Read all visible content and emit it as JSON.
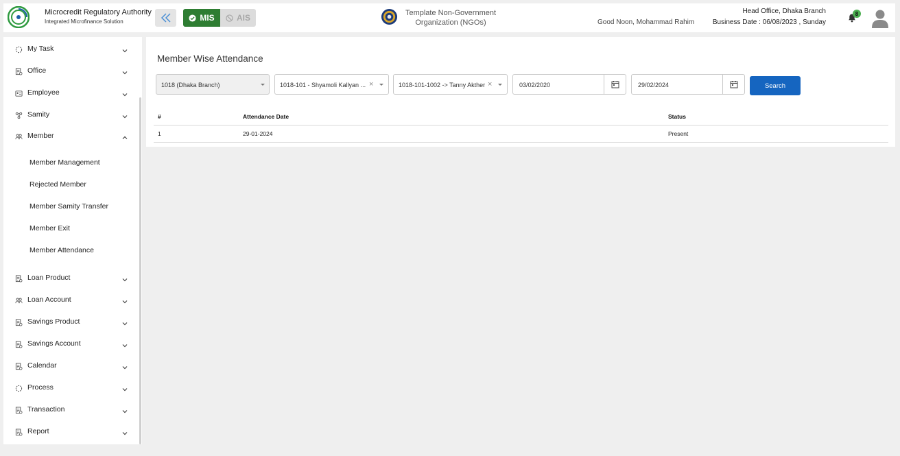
{
  "header": {
    "org_name": "Microcredit Regulatory Authority",
    "org_sub": "Integrated Microfinance Solution",
    "logo_text": "Microcredit Regulatory Authority",
    "mis_label": "MIS",
    "ais_label": "AIS",
    "ngo_line1": "Template Non-Government",
    "ngo_line2": "Organization (NGOs)",
    "greeting": "Good Noon, Mohammad Rahim",
    "branch": "Head Office, Dhaka Branch",
    "business_date": "Business Date : 06/08/2023 , Sunday",
    "notification_count": "8"
  },
  "sidebar": {
    "items": [
      {
        "label": "My Task",
        "icon": "spinner-icon"
      },
      {
        "label": "Office",
        "icon": "document-icon"
      },
      {
        "label": "Employee",
        "icon": "id-card-icon"
      },
      {
        "label": "Samity",
        "icon": "network-icon"
      },
      {
        "label": "Member",
        "icon": "group-icon"
      },
      {
        "label": "Loan Product",
        "icon": "document-icon"
      },
      {
        "label": "Loan Account",
        "icon": "group-icon"
      },
      {
        "label": "Savings Product",
        "icon": "document-icon"
      },
      {
        "label": "Savings Account",
        "icon": "document-icon"
      },
      {
        "label": "Calendar",
        "icon": "document-icon"
      },
      {
        "label": "Process",
        "icon": "spinner-icon"
      },
      {
        "label": "Transaction",
        "icon": "document-icon"
      },
      {
        "label": "Report",
        "icon": "document-icon"
      }
    ],
    "member_sub": [
      "Member Management",
      "Rejected Member",
      "Member Samity Transfer",
      "Member Exit",
      "Member Attendance"
    ]
  },
  "main": {
    "title": "Member Wise Attendance",
    "filters": {
      "branch": "1018 (Dhaka Branch)",
      "samity": "1018-101 - Shyamoli Kallyan ...",
      "member": "1018-101-1002 -> Tanny Akther",
      "from_date": "03/02/2020",
      "to_date": "29/02/2024",
      "search_label": "Search"
    },
    "table": {
      "headers": [
        "#",
        "Attendance Date",
        "Status"
      ],
      "rows": [
        [
          "1",
          "29-01-2024",
          "Present"
        ]
      ]
    }
  },
  "colors": {
    "accent_blue": "#1565c0",
    "mis_green": "#2e7d32",
    "badge_green": "#4caf50"
  }
}
